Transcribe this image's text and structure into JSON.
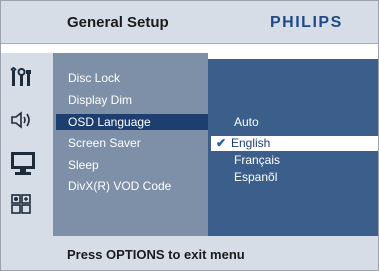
{
  "header": {
    "title": "General Setup",
    "brand": "PHILIPS"
  },
  "sidebar_icons": [
    "setup-tools-icon",
    "speaker-audio-icon",
    "monitor-video-icon",
    "preferences-grid-icon"
  ],
  "menu": {
    "items": [
      {
        "label": "Disc Lock",
        "selected": false
      },
      {
        "label": "Display Dim",
        "selected": false
      },
      {
        "label": "OSD Language",
        "selected": true
      },
      {
        "label": "Screen Saver",
        "selected": false
      },
      {
        "label": "Sleep",
        "selected": false
      },
      {
        "label": "DivX(R) VOD Code",
        "selected": false
      }
    ]
  },
  "options": {
    "items": [
      {
        "label": "Auto",
        "selected": false
      },
      {
        "label": "English",
        "selected": true
      },
      {
        "label": "Français",
        "selected": false
      },
      {
        "label": "Espanõl",
        "selected": false
      }
    ]
  },
  "footer": {
    "hint": "Press OPTIONS to exit menu"
  },
  "colors": {
    "panel_light": "#d6dde6",
    "menu_bg": "#7e8fa8",
    "options_bg": "#3b5e8a",
    "highlight": "#1d3e6f",
    "brand": "#1f4a8a"
  }
}
